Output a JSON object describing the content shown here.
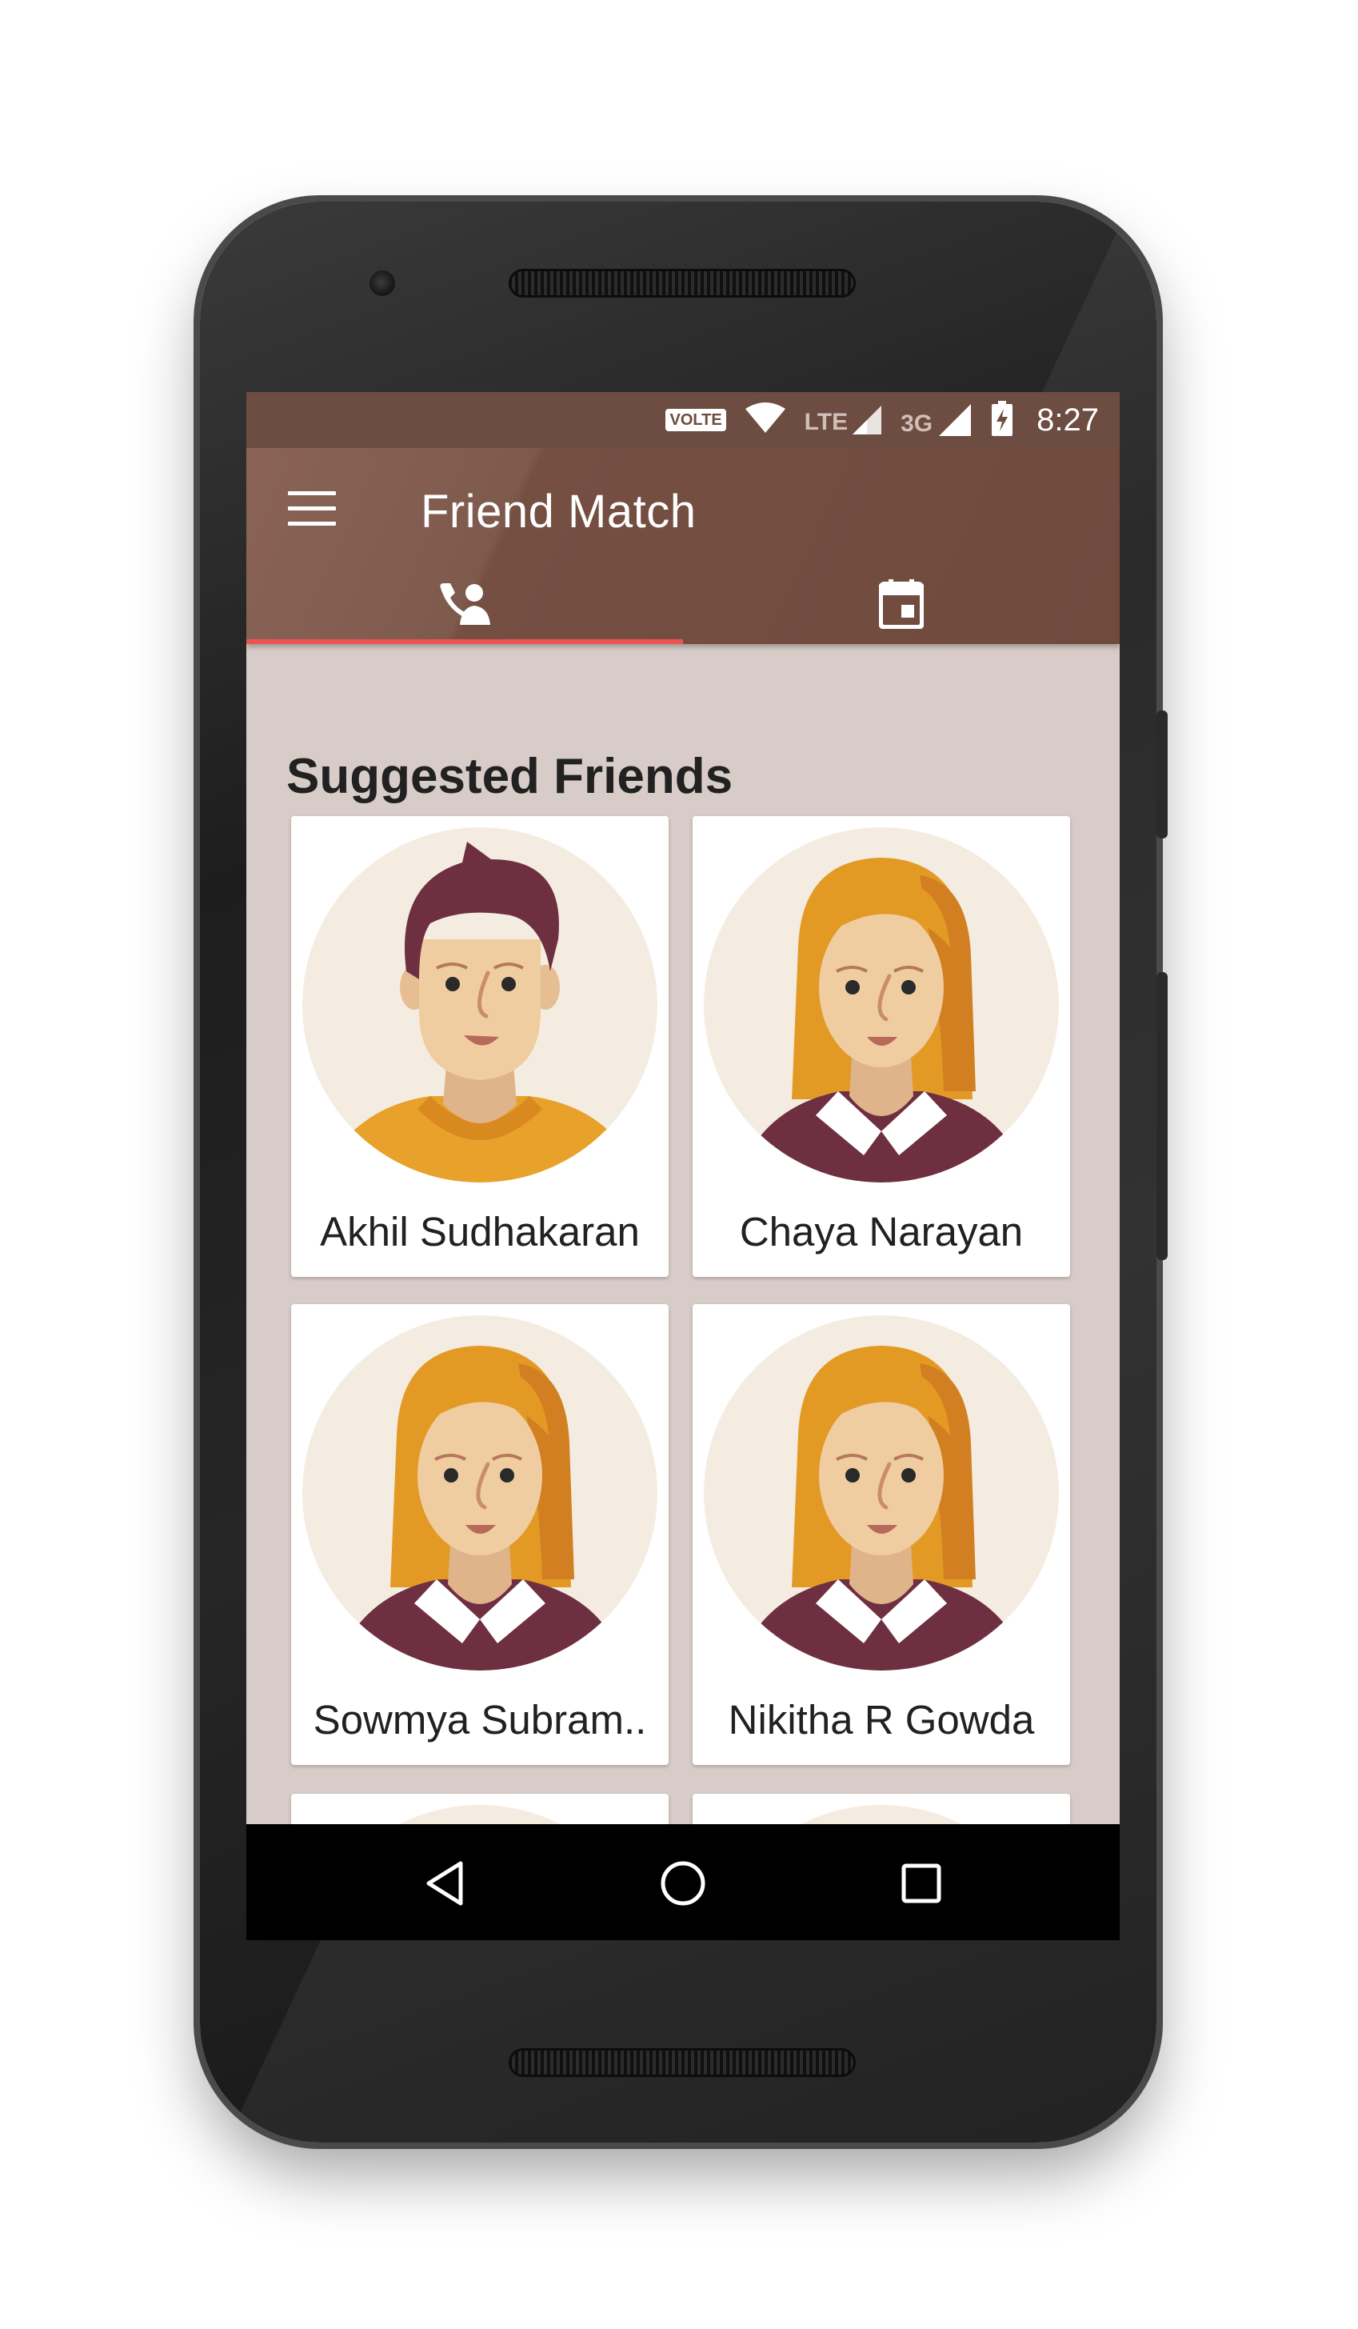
{
  "status_bar": {
    "volte": "VOLTE",
    "lte": "LTE",
    "net_3g": "3G",
    "time": "8:27"
  },
  "app_bar": {
    "title": "Friend Match",
    "tabs": [
      {
        "icon": "contact-phone-icon",
        "selected": true
      },
      {
        "icon": "calendar-icon",
        "selected": false
      }
    ]
  },
  "section_title": "Suggested Friends",
  "friends": [
    {
      "name": "Akhil Sudhakaran",
      "avatar": "male-avatar-icon"
    },
    {
      "name": "Chaya Narayan",
      "avatar": "female-avatar-icon"
    },
    {
      "name": "Sowmya Subram..",
      "avatar": "female-avatar-icon"
    },
    {
      "name": "Nikitha R Gowda",
      "avatar": "female-avatar-icon"
    }
  ],
  "nav_bar": {
    "buttons": [
      "back-icon",
      "home-icon",
      "recents-icon"
    ]
  },
  "colors": {
    "app_bar": "#7b5649",
    "status_bar": "#6d4c41",
    "tab_indicator": "#ef5350",
    "background": "#d8ccc8"
  }
}
